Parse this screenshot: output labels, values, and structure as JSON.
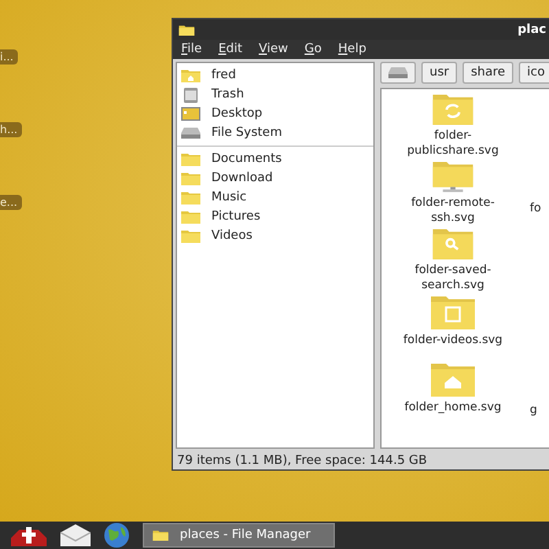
{
  "desktop": {
    "icon_labels": [
      {
        "label": "i..."
      },
      {
        "label": "h..."
      },
      {
        "label": "e..."
      }
    ]
  },
  "window": {
    "title": "plac",
    "menu": [
      "File",
      "Edit",
      "View",
      "Go",
      "Help"
    ],
    "sidebar": {
      "places": [
        {
          "label": "fred",
          "kind": "home"
        },
        {
          "label": "Trash",
          "kind": "trash"
        },
        {
          "label": "Desktop",
          "kind": "desktop"
        },
        {
          "label": "File System",
          "kind": "drive"
        }
      ],
      "bookmarks": [
        {
          "label": "Documents",
          "kind": "folder"
        },
        {
          "label": "Download",
          "kind": "folder"
        },
        {
          "label": "Music",
          "kind": "folder"
        },
        {
          "label": "Pictures",
          "kind": "folder"
        },
        {
          "label": "Videos",
          "kind": "folder"
        }
      ]
    },
    "path_bar": [
      {
        "kind": "drive"
      },
      {
        "kind": "text",
        "label": "usr"
      },
      {
        "kind": "text",
        "label": "share"
      },
      {
        "kind": "text",
        "label": "ico"
      }
    ],
    "files": [
      {
        "label": "folder-\npublicshare.svg",
        "kind": "sync"
      },
      {
        "label": "folder-remote-\nssh.svg",
        "kind": "remote",
        "next_label": "fo"
      },
      {
        "label": "folder-saved-\nsearch.svg",
        "kind": "search"
      },
      {
        "label": "folder-videos.svg",
        "kind": "video"
      },
      {
        "label": "folder_home.svg",
        "kind": "home",
        "next_label": "g"
      }
    ],
    "status_bar": "79 items (1.1 MB), Free space: 144.5 GB"
  },
  "taskbar": {
    "launchers": [
      {
        "kind": "box"
      },
      {
        "kind": "mail"
      },
      {
        "kind": "globe"
      }
    ],
    "tasks": [
      {
        "label": "places - File Manager"
      }
    ]
  }
}
